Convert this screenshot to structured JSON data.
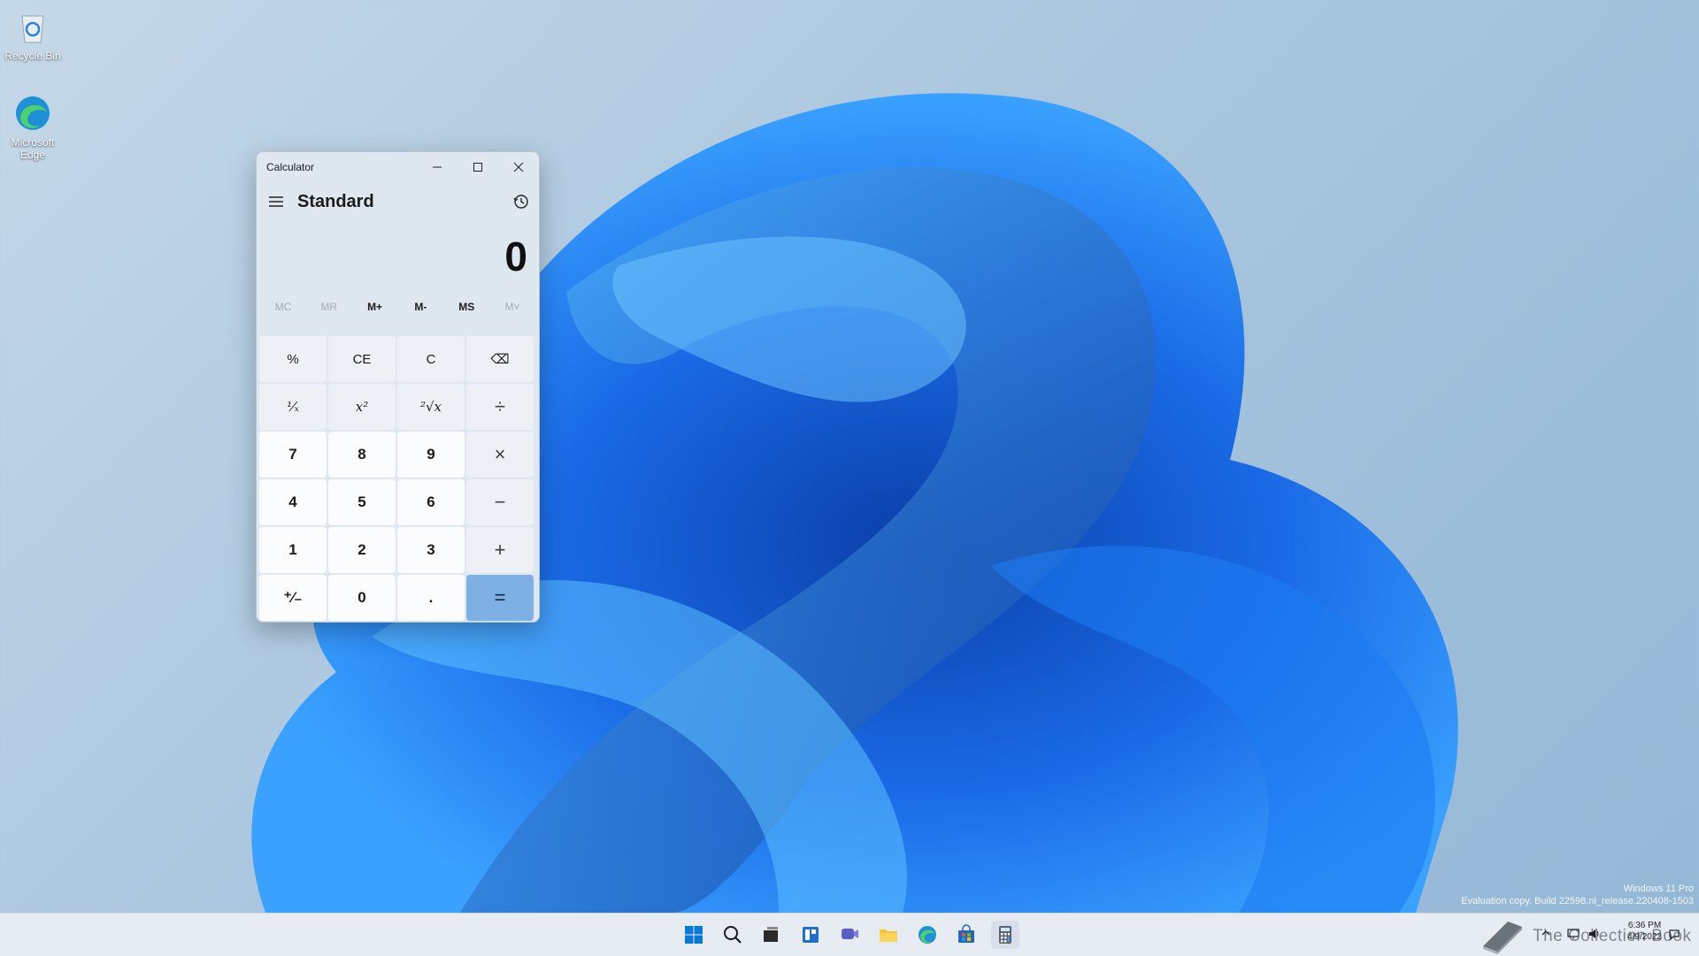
{
  "desktop": {
    "icons": [
      {
        "label": "Recycle Bin",
        "icon": "recycle-bin-icon"
      },
      {
        "label": "Microsoft Edge",
        "icon": "edge-icon"
      }
    ],
    "watermark_line1": "Windows 11 Pro",
    "watermark_line2": "Evaluation copy. Build 22598.ni_release.220408-1503"
  },
  "calculator": {
    "window_title": "Calculator",
    "mode": "Standard",
    "display_value": "0",
    "memory_buttons": [
      "MC",
      "MR",
      "M+",
      "M-",
      "MS",
      "M˅"
    ],
    "keys": {
      "percent": "%",
      "ce": "CE",
      "c": "C",
      "backspace": "⌫",
      "reciprocal": "¹⁄ₓ",
      "square": "x²",
      "sqrt": "²√x",
      "divide": "÷",
      "seven": "7",
      "eight": "8",
      "nine": "9",
      "multiply": "×",
      "four": "4",
      "five": "5",
      "six": "6",
      "minus": "−",
      "one": "1",
      "two": "2",
      "three": "3",
      "plus": "+",
      "negate": "⁺⁄₋",
      "zero": "0",
      "decimal": ".",
      "equals": "="
    }
  },
  "taskbar": {
    "apps": [
      "start-icon",
      "search-icon",
      "task-view-icon",
      "widgets-icon",
      "chat-icon",
      "file-explorer-icon",
      "edge-icon",
      "store-icon",
      "calculator-icon"
    ],
    "clock_time": "6:36 PM",
    "clock_date": "4/9/2022",
    "brand_text": "The Collection Book"
  },
  "colors": {
    "accent": "#0067c0",
    "equals_key": "#7fb0e3"
  }
}
